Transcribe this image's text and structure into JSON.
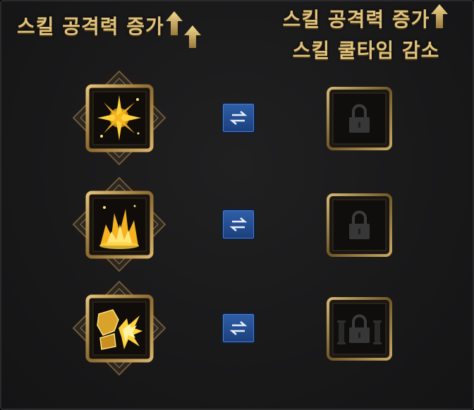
{
  "header": {
    "left_label": "스킬 공격력 증가",
    "right_label_line1": "스킬 공격력 증가",
    "right_label_line2": "스킬 쿨타임 감소"
  },
  "rows": [
    {
      "skill_icon": "burst-star-icon",
      "swap_icon": "swap-arrows-icon",
      "locked_icon": "padlock-icon"
    },
    {
      "skill_icon": "flame-explosion-icon",
      "swap_icon": "swap-arrows-icon",
      "locked_icon": "padlock-icon"
    },
    {
      "skill_icon": "gauntlet-strike-icon",
      "swap_icon": "swap-arrows-icon",
      "locked_icon": "padlock-icon"
    }
  ],
  "colors": {
    "gold_text": "#e0c27c",
    "panel_bg": "#19191a",
    "swap_button": "#2a5aa0",
    "skill_glow": "#ffd23a"
  }
}
